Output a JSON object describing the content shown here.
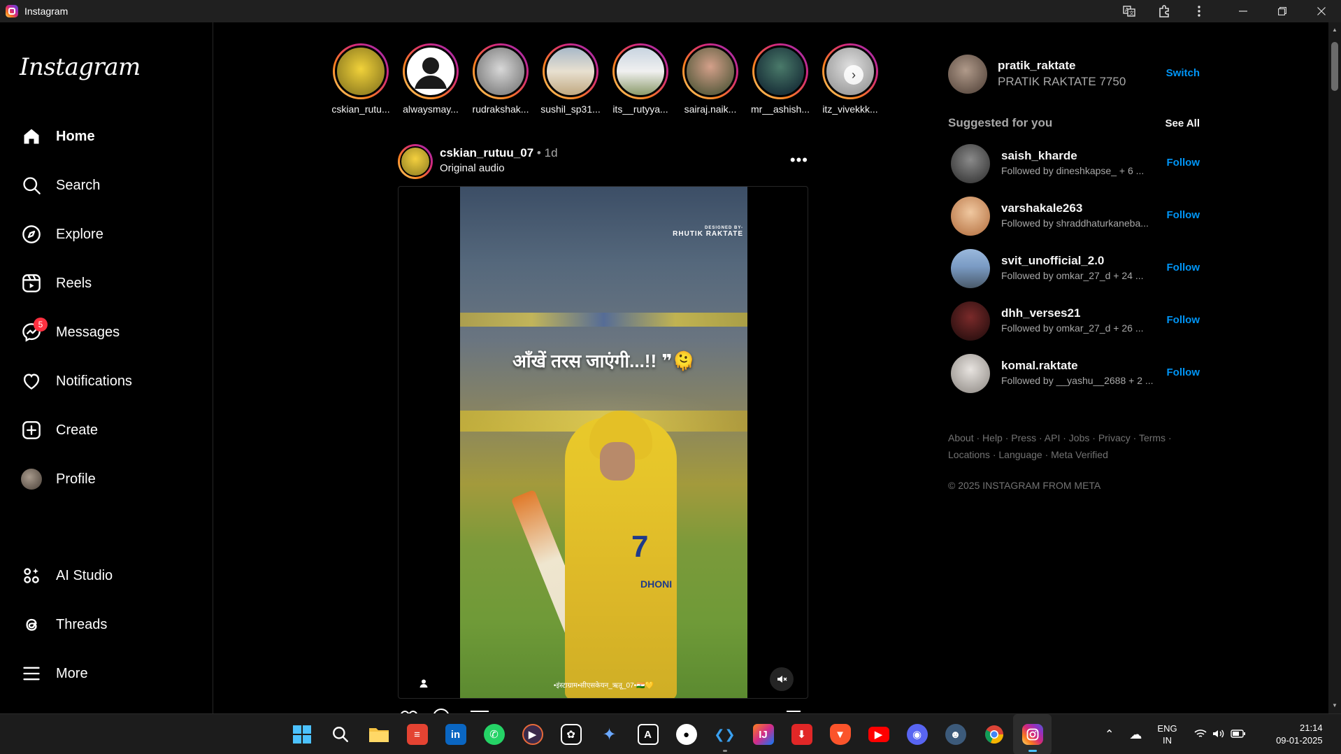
{
  "window": {
    "title": "Instagram"
  },
  "sidebar": {
    "logo": "Instagram",
    "items": [
      {
        "label": "Home",
        "icon": "home-icon"
      },
      {
        "label": "Search",
        "icon": "search-icon"
      },
      {
        "label": "Explore",
        "icon": "compass-icon"
      },
      {
        "label": "Reels",
        "icon": "reels-icon"
      },
      {
        "label": "Messages",
        "icon": "messenger-icon",
        "badge": "5"
      },
      {
        "label": "Notifications",
        "icon": "heart-icon"
      },
      {
        "label": "Create",
        "icon": "plus-square-icon"
      },
      {
        "label": "Profile",
        "icon": "avatar"
      },
      {
        "label": "AI Studio",
        "icon": "ai-studio-icon"
      },
      {
        "label": "Threads",
        "icon": "threads-icon"
      },
      {
        "label": "More",
        "icon": "hamburger-icon"
      }
    ]
  },
  "stories": [
    {
      "name": "cskian_rutu..."
    },
    {
      "name": "alwaysmay..."
    },
    {
      "name": "rudrakshak..."
    },
    {
      "name": "sushil_sp31..."
    },
    {
      "name": "its__rutyya..."
    },
    {
      "name": "sairaj.naik..."
    },
    {
      "name": "mr__ashish..."
    },
    {
      "name": "itz_vivekkk..."
    }
  ],
  "post": {
    "username": "cskian_rutuu_07",
    "dot": "•",
    "time": "1d",
    "audio": "Original audio",
    "more": "•••",
    "overlay_text": "आँखें तरस जाएंगी...!! ❞🫠",
    "designer_small": "DESIGNED BY-",
    "designer": "RHUTIK RAKTATE",
    "jersey_num": "7",
    "jersey_name": "DHONI",
    "bottom_caption": "•इंस्टाग्राम•सीएसकेयन_ऋतू_07•🇮🇳💛"
  },
  "me": {
    "username": "pratik_raktate",
    "name": "PRATIK RAKTATE 7750",
    "switch": "Switch"
  },
  "suggested": {
    "title": "Suggested for you",
    "see_all": "See All",
    "items": [
      {
        "username": "saish_kharde",
        "sub": "Followed by dineshkapse_ + 6 ...",
        "action": "Follow",
        "color": "#6b6b6b"
      },
      {
        "username": "varshakale263",
        "sub": "Followed by shraddhaturkaneba...",
        "action": "Follow",
        "color": "#e6b08a"
      },
      {
        "username": "svit_unofficial_2.0",
        "sub": "Followed by omkar_27_d + 24 ...",
        "action": "Follow",
        "color": "#7a9bc4"
      },
      {
        "username": "dhh_verses21",
        "sub": "Followed by omkar_27_d + 26 ...",
        "action": "Follow",
        "color": "#5a1a1a"
      },
      {
        "username": "komal.raktate",
        "sub": "Followed by __yashu__2688 + 2 ...",
        "action": "Follow",
        "color": "#c8c2bd"
      }
    ]
  },
  "footer": {
    "links": [
      "About",
      "Help",
      "Press",
      "API",
      "Jobs",
      "Privacy",
      "Terms",
      "Locations",
      "Language",
      "Meta Verified"
    ],
    "copyright": "© 2025 INSTAGRAM FROM META"
  },
  "taskbar": {
    "apps": [
      {
        "name": "windows-start",
        "color": "#0a84ff",
        "glyph": ""
      },
      {
        "name": "search",
        "color": "transparent",
        "glyph": ""
      },
      {
        "name": "file-explorer",
        "color": "#f5c242",
        "glyph": ""
      },
      {
        "name": "todoist",
        "color": "#e44332",
        "glyph": "≡"
      },
      {
        "name": "linkedin",
        "color": "#0a66c2",
        "glyph": "in"
      },
      {
        "name": "whatsapp",
        "color": "#25d366",
        "glyph": "✆"
      },
      {
        "name": "media-player",
        "color": "#3a3a3a",
        "glyph": "▶"
      },
      {
        "name": "chatgpt",
        "color": "#2b2b2b",
        "glyph": "✿"
      },
      {
        "name": "gemini",
        "color": "transparent",
        "glyph": "✦"
      },
      {
        "name": "ms-store",
        "color": "#2b2b2b",
        "glyph": "A"
      },
      {
        "name": "github",
        "color": "#2b2b2b",
        "glyph": "●"
      },
      {
        "name": "vscode",
        "color": "transparent",
        "glyph": "❮❯"
      },
      {
        "name": "intellij",
        "color": "#d12b8a",
        "glyph": "IJ"
      },
      {
        "name": "downloader",
        "color": "#e12727",
        "glyph": "⬇"
      },
      {
        "name": "brave",
        "color": "#fb542b",
        "glyph": "▼"
      },
      {
        "name": "youtube",
        "color": "#ff0000",
        "glyph": "▶"
      },
      {
        "name": "discord",
        "color": "#5865f2",
        "glyph": "◉"
      },
      {
        "name": "avatar-app",
        "color": "#3c5a7a",
        "glyph": "☻"
      },
      {
        "name": "chrome",
        "color": "#34a853",
        "glyph": "◎"
      },
      {
        "name": "instagram",
        "color": "#d62976",
        "glyph": "◻"
      }
    ],
    "lang_top": "ENG",
    "lang_bottom": "IN",
    "time": "21:14",
    "date": "09-01-2025"
  }
}
